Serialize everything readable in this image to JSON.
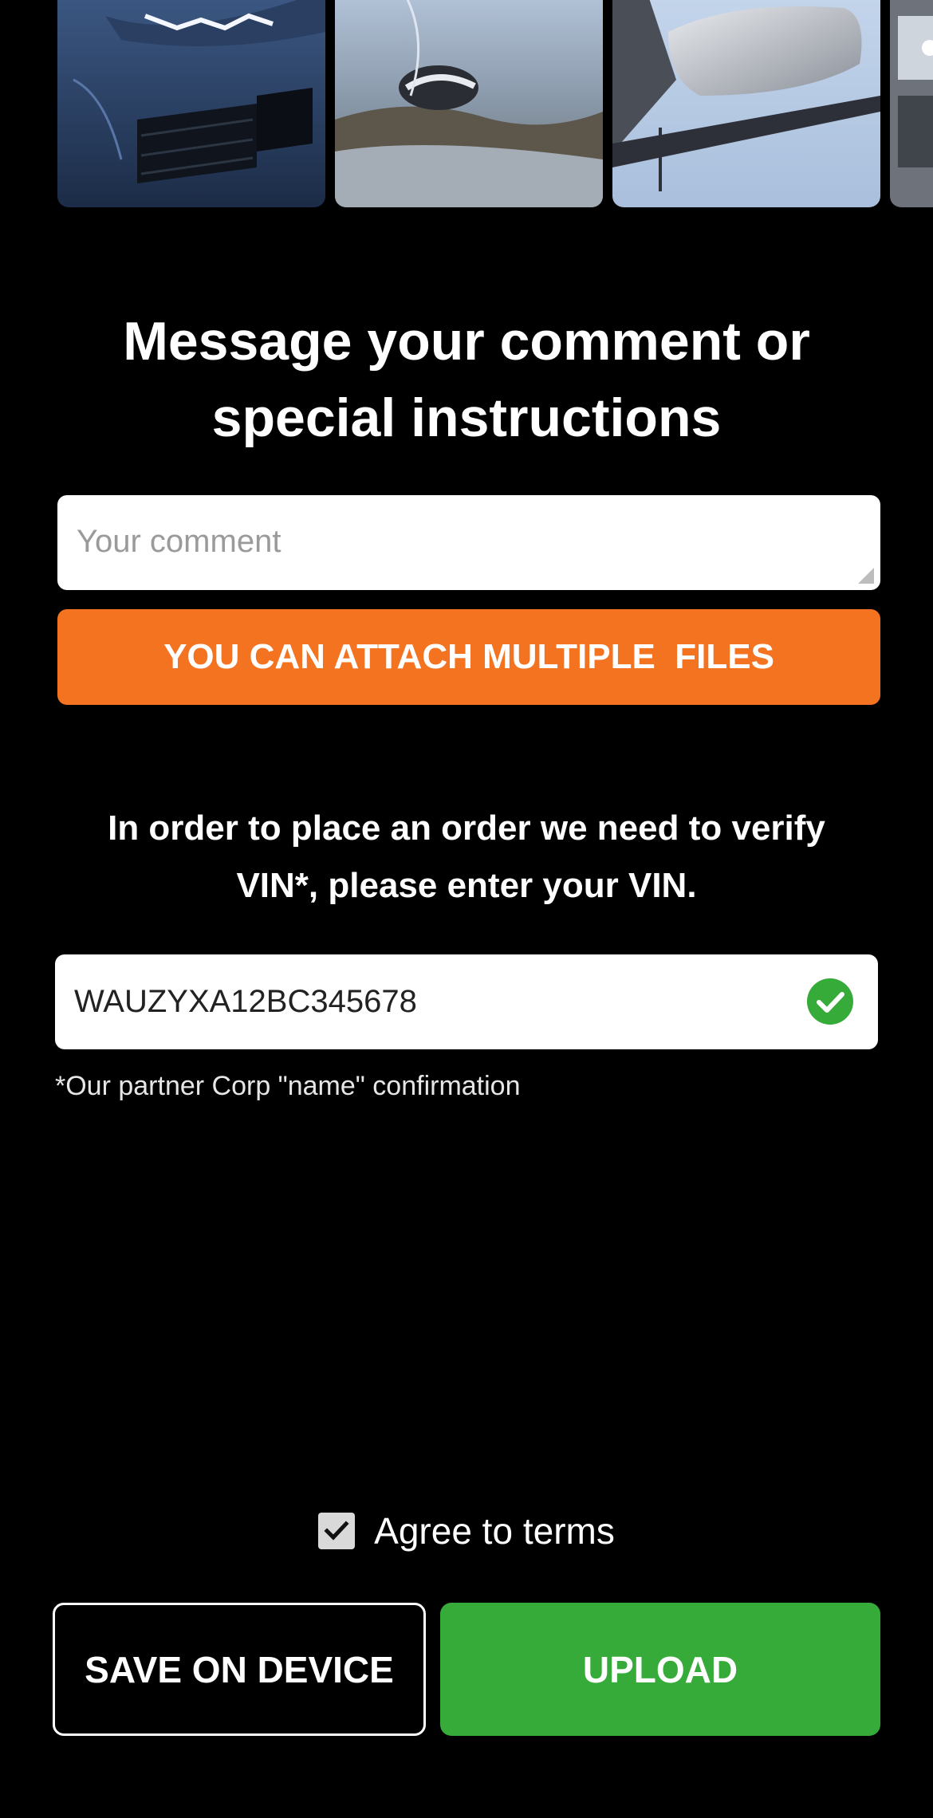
{
  "gallery": {
    "photos": [
      {
        "subject": "car-headlight"
      },
      {
        "subject": "car-door-handle"
      },
      {
        "subject": "car-side-mirror"
      },
      {
        "subject": "car-partial"
      }
    ]
  },
  "comment_section": {
    "title": "Message your comment or special instructions",
    "placeholder": "Your comment",
    "value": ""
  },
  "attach": {
    "label": "YOU CAN ATTACH MULTIPLE  FILES",
    "color": "#f47321"
  },
  "vin_section": {
    "instructions": "In order to place an order we need to verify VIN*, please enter your VIN.",
    "value": "WAUZYXA12BC345678",
    "status_icon": "check-circle-icon",
    "status_color": "#37ab39",
    "note": "*Our partner Corp \"name\" confirmation"
  },
  "terms": {
    "checked": true,
    "label": "Agree to terms"
  },
  "actions": {
    "save_label": "SAVE ON DEVICE",
    "upload_label": "UPLOAD",
    "upload_color": "#37ab39"
  }
}
